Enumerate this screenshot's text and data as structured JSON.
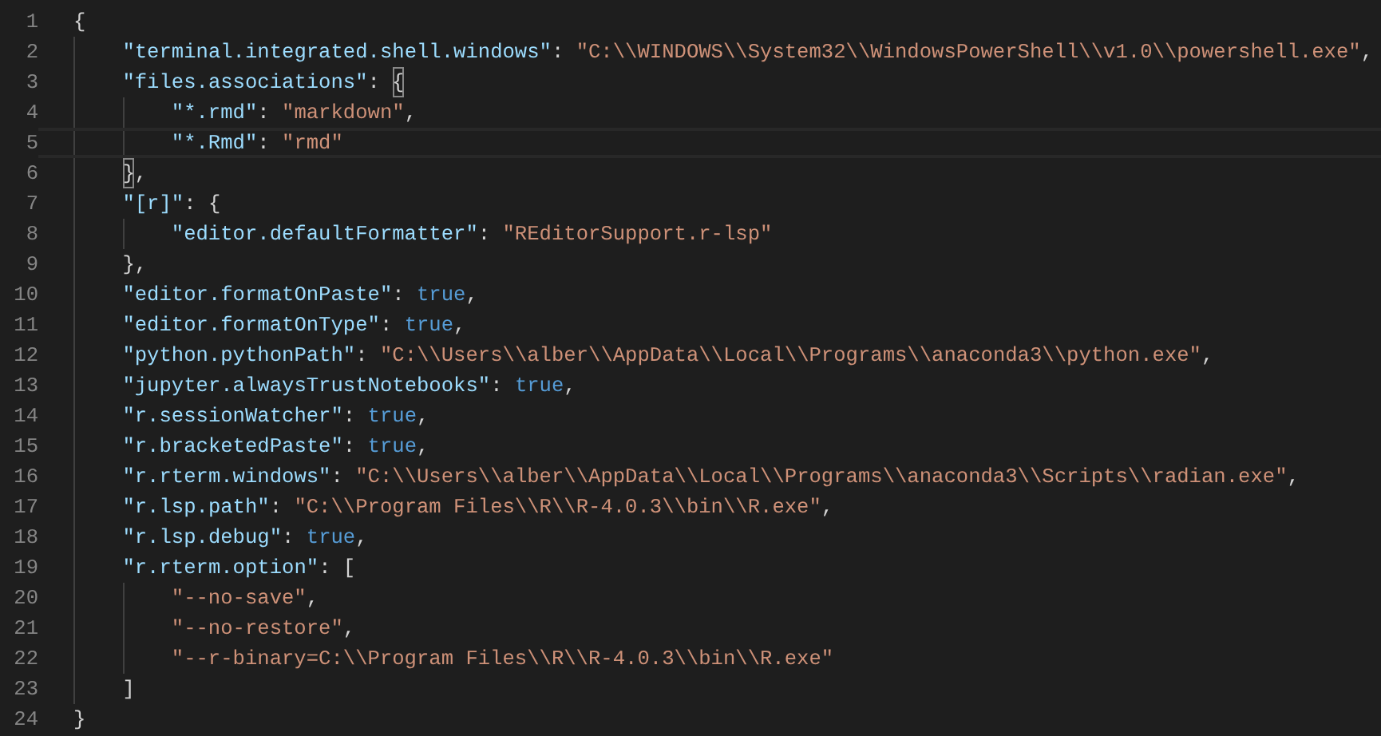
{
  "editor": {
    "lines": [
      {
        "number": "1",
        "tokens": [
          {
            "kind": "punct",
            "text": "{"
          }
        ],
        "children": [
          {
            "number": "2",
            "tokens": [
              {
                "kind": "key",
                "text": "\"terminal.integrated.shell.windows\""
              },
              {
                "kind": "punct",
                "text": ": "
              },
              {
                "kind": "string",
                "text": "\"C:\\\\WINDOWS\\\\System32\\\\WindowsPowerShell\\\\v1.0\\\\powershell.exe\""
              },
              {
                "kind": "punct",
                "text": ","
              }
            ]
          },
          {
            "number": "3",
            "tokens": [
              {
                "kind": "key",
                "text": "\"files.associations\""
              },
              {
                "kind": "punct",
                "text": ": "
              },
              {
                "kind": "punct",
                "text": "{",
                "matched": true
              }
            ],
            "children": [
              {
                "number": "4",
                "tokens": [
                  {
                    "kind": "key",
                    "text": "\"*.rmd\""
                  },
                  {
                    "kind": "punct",
                    "text": ": "
                  },
                  {
                    "kind": "string",
                    "text": "\"markdown\""
                  },
                  {
                    "kind": "punct",
                    "text": ","
                  }
                ]
              },
              {
                "number": "5",
                "current": true,
                "tokens": [
                  {
                    "kind": "key",
                    "text": "\"*.Rmd\""
                  },
                  {
                    "kind": "punct",
                    "text": ": "
                  },
                  {
                    "kind": "string",
                    "text": "\"rmd\""
                  }
                ]
              }
            ]
          },
          {
            "number": "6",
            "tokens": [
              {
                "kind": "punct",
                "text": "}",
                "matched": true
              },
              {
                "kind": "punct",
                "text": ","
              }
            ]
          },
          {
            "number": "7",
            "tokens": [
              {
                "kind": "key",
                "text": "\"[r]\""
              },
              {
                "kind": "punct",
                "text": ": {"
              }
            ],
            "children": [
              {
                "number": "8",
                "tokens": [
                  {
                    "kind": "key",
                    "text": "\"editor.defaultFormatter\""
                  },
                  {
                    "kind": "punct",
                    "text": ": "
                  },
                  {
                    "kind": "string",
                    "text": "\"REditorSupport.r-lsp\""
                  }
                ]
              }
            ]
          },
          {
            "number": "9",
            "tokens": [
              {
                "kind": "punct",
                "text": "},"
              }
            ]
          },
          {
            "number": "10",
            "tokens": [
              {
                "kind": "key",
                "text": "\"editor.formatOnPaste\""
              },
              {
                "kind": "punct",
                "text": ": "
              },
              {
                "kind": "keyword",
                "text": "true"
              },
              {
                "kind": "punct",
                "text": ","
              }
            ]
          },
          {
            "number": "11",
            "tokens": [
              {
                "kind": "key",
                "text": "\"editor.formatOnType\""
              },
              {
                "kind": "punct",
                "text": ": "
              },
              {
                "kind": "keyword",
                "text": "true"
              },
              {
                "kind": "punct",
                "text": ","
              }
            ]
          },
          {
            "number": "12",
            "tokens": [
              {
                "kind": "key",
                "text": "\"python.pythonPath\""
              },
              {
                "kind": "punct",
                "text": ": "
              },
              {
                "kind": "string",
                "text": "\"C:\\\\Users\\\\alber\\\\AppData\\\\Local\\\\Programs\\\\anaconda3\\\\python.exe\""
              },
              {
                "kind": "punct",
                "text": ","
              }
            ]
          },
          {
            "number": "13",
            "tokens": [
              {
                "kind": "key",
                "text": "\"jupyter.alwaysTrustNotebooks\""
              },
              {
                "kind": "punct",
                "text": ": "
              },
              {
                "kind": "keyword",
                "text": "true"
              },
              {
                "kind": "punct",
                "text": ","
              }
            ]
          },
          {
            "number": "14",
            "tokens": [
              {
                "kind": "key",
                "text": "\"r.sessionWatcher\""
              },
              {
                "kind": "punct",
                "text": ": "
              },
              {
                "kind": "keyword",
                "text": "true"
              },
              {
                "kind": "punct",
                "text": ","
              }
            ]
          },
          {
            "number": "15",
            "tokens": [
              {
                "kind": "key",
                "text": "\"r.bracketedPaste\""
              },
              {
                "kind": "punct",
                "text": ": "
              },
              {
                "kind": "keyword",
                "text": "true"
              },
              {
                "kind": "punct",
                "text": ","
              }
            ]
          },
          {
            "number": "16",
            "tokens": [
              {
                "kind": "key",
                "text": "\"r.rterm.windows\""
              },
              {
                "kind": "punct",
                "text": ": "
              },
              {
                "kind": "string",
                "text": "\"C:\\\\Users\\\\alber\\\\AppData\\\\Local\\\\Programs\\\\anaconda3\\\\Scripts\\\\radian.exe\""
              },
              {
                "kind": "punct",
                "text": ","
              }
            ]
          },
          {
            "number": "17",
            "tokens": [
              {
                "kind": "key",
                "text": "\"r.lsp.path\""
              },
              {
                "kind": "punct",
                "text": ": "
              },
              {
                "kind": "string",
                "text": "\"C:\\\\Program Files\\\\R\\\\R-4.0.3\\\\bin\\\\R.exe\""
              },
              {
                "kind": "punct",
                "text": ","
              }
            ]
          },
          {
            "number": "18",
            "tokens": [
              {
                "kind": "key",
                "text": "\"r.lsp.debug\""
              },
              {
                "kind": "punct",
                "text": ": "
              },
              {
                "kind": "keyword",
                "text": "true"
              },
              {
                "kind": "punct",
                "text": ","
              }
            ]
          },
          {
            "number": "19",
            "tokens": [
              {
                "kind": "key",
                "text": "\"r.rterm.option\""
              },
              {
                "kind": "punct",
                "text": ": ["
              }
            ],
            "children": [
              {
                "number": "20",
                "tokens": [
                  {
                    "kind": "string",
                    "text": "\"--no-save\""
                  },
                  {
                    "kind": "punct",
                    "text": ","
                  }
                ]
              },
              {
                "number": "21",
                "tokens": [
                  {
                    "kind": "string",
                    "text": "\"--no-restore\""
                  },
                  {
                    "kind": "punct",
                    "text": ","
                  }
                ]
              },
              {
                "number": "22",
                "tokens": [
                  {
                    "kind": "string",
                    "text": "\"--r-binary=C:\\\\Program Files\\\\R\\\\R-4.0.3\\\\bin\\\\R.exe\""
                  }
                ]
              }
            ]
          },
          {
            "number": "23",
            "tokens": [
              {
                "kind": "punct",
                "text": "]"
              }
            ]
          }
        ]
      },
      {
        "number": "24",
        "tokens": [
          {
            "kind": "punct",
            "text": "}"
          }
        ]
      }
    ]
  }
}
